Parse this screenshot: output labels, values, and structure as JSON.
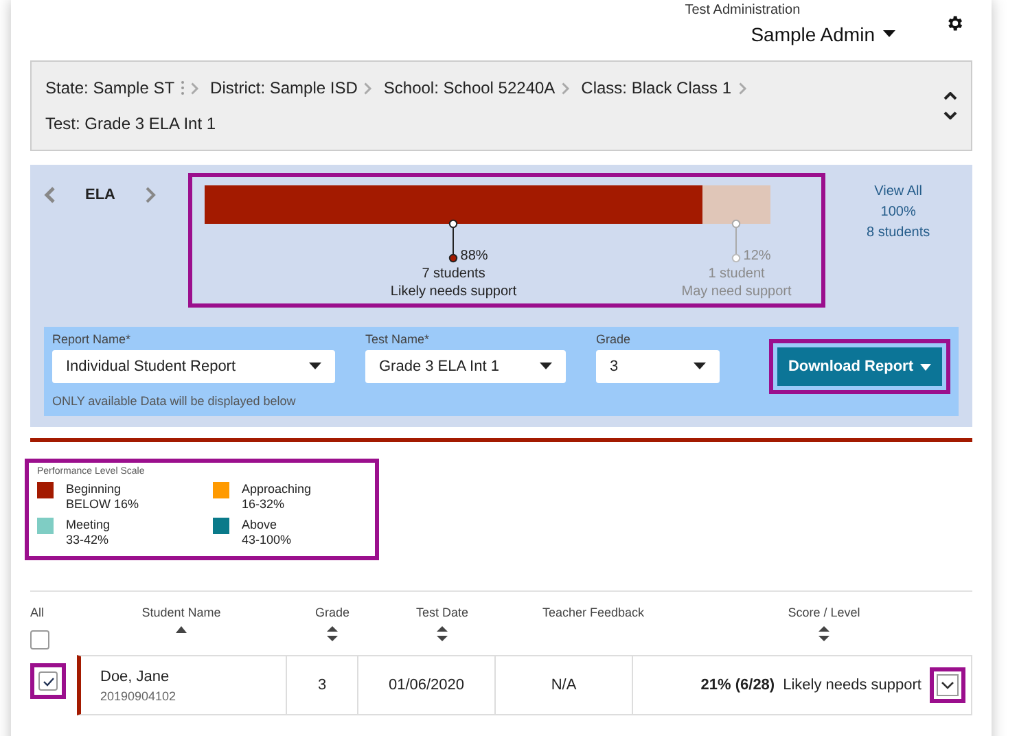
{
  "header": {
    "caption": "Test Administration",
    "admin": "Sample Admin"
  },
  "breadcrumb": {
    "items": [
      "State: Sample ST",
      "District:  Sample ISD",
      "School: School 52240A",
      "Class: Black Class 1"
    ],
    "test": "Test: Grade 3 ELA Int 1"
  },
  "subject": {
    "name": "ELA",
    "segments": [
      {
        "selected": true,
        "students": "7 students",
        "label": "Likely needs support"
      },
      {
        "selected": false,
        "students": "1 student",
        "label": "May need support"
      }
    ],
    "chart_data": {
      "type": "bar",
      "orientation": "horizontal",
      "stacked": true,
      "series": [
        {
          "color": "#a31a00",
          "values": [
            88
          ],
          "value_labels": [
            "88%"
          ]
        },
        {
          "color": "#e0c6b8",
          "values": [
            12
          ],
          "value_labels": [
            "12%"
          ]
        }
      ]
    },
    "view_all": {
      "label": "View All",
      "percent": "100%",
      "students": "8 students"
    }
  },
  "filters": [
    {
      "label": "Report Name*",
      "value": "Individual Student Report"
    },
    {
      "label": "Test Name*",
      "value": "Grade 3 ELA Int 1"
    },
    {
      "label": "Grade",
      "value": "3"
    }
  ],
  "filters_note": "ONLY available Data will be displayed below",
  "download_button": "Download Report",
  "legend": {
    "title": "Performance Level Scale",
    "items": [
      {
        "name": "Beginning",
        "range": "BELOW 16%",
        "color": "#a31a00"
      },
      {
        "name": "Approaching",
        "range": "16-32%",
        "color": "#ff9a00"
      },
      {
        "name": "Meeting",
        "range": "33-42%",
        "color": "#7fcdc4"
      },
      {
        "name": "Above",
        "range": "43-100%",
        "color": "#0a7a8a"
      }
    ]
  },
  "table": {
    "select_all": {
      "label": "All",
      "checked": false
    },
    "columns": [
      {
        "label": "Student Name",
        "kind": "ascending"
      },
      {
        "label": "Grade",
        "kind": "sortable"
      },
      {
        "label": "Test Date",
        "kind": "sortable"
      },
      {
        "label": "Teacher Feedback",
        "kind": "plain"
      },
      {
        "label": "Score / Level",
        "kind": "sortable"
      }
    ],
    "rows": [
      {
        "checked": true,
        "name": "Doe, Jane",
        "id": "20190904102",
        "grade": "3",
        "date": "01/06/2020",
        "feedback": "N/A",
        "score": "21% (6/28)",
        "level": "Likely needs support",
        "color": "#a31a00"
      }
    ]
  }
}
